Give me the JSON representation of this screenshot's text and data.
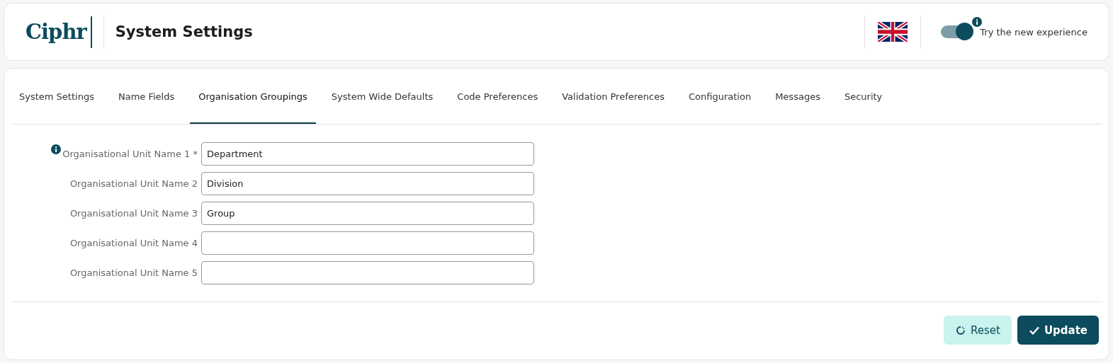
{
  "header": {
    "logo": "Ciphr",
    "title": "System Settings",
    "toggle": {
      "label": "Try the new experience",
      "on": true,
      "info": true
    }
  },
  "tabs": [
    {
      "label": "System Settings",
      "selected": false
    },
    {
      "label": "Name Fields",
      "selected": false
    },
    {
      "label": "Organisation Groupings",
      "selected": true
    },
    {
      "label": "System Wide Defaults",
      "selected": false
    },
    {
      "label": "Code Preferences",
      "selected": false
    },
    {
      "label": "Validation Preferences",
      "selected": false
    },
    {
      "label": "Configuration",
      "selected": false
    },
    {
      "label": "Messages",
      "selected": false
    },
    {
      "label": "Security",
      "selected": false
    }
  ],
  "fields": [
    {
      "label": "Organisational Unit Name 1 *",
      "value": "Department",
      "info": true
    },
    {
      "label": "Organisational Unit Name 2",
      "value": "Division",
      "info": false
    },
    {
      "label": "Organisational Unit Name 3",
      "value": "Group",
      "info": false
    },
    {
      "label": "Organisational Unit Name 4",
      "info": false
    },
    {
      "label": "Organisational Unit Name 5",
      "info": false
    }
  ],
  "buttons": [
    {
      "label": "Reset",
      "kind": "reset"
    },
    {
      "label": "Update",
      "kind": "update"
    }
  ]
}
